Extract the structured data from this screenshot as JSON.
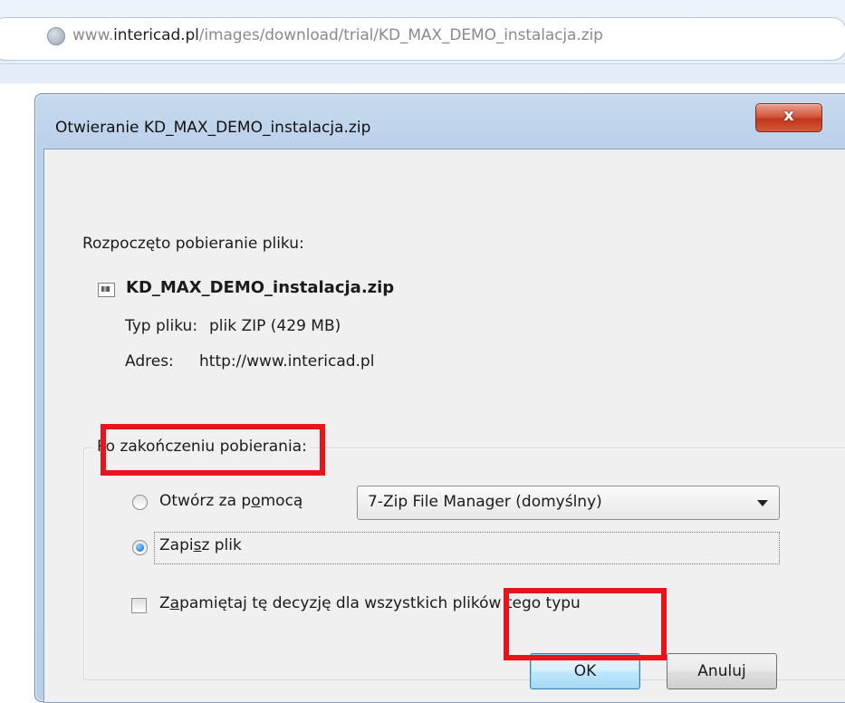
{
  "browser": {
    "url_prefix": "www.",
    "url_domain": "intericad.pl",
    "url_path": "/images/download/trial/KD_MAX_DEMO_instalacja.zip"
  },
  "dialog": {
    "title": "Otwieranie KD_MAX_DEMO_instalacja.zip",
    "close_label": "x",
    "download_started": "Rozpoczęto pobieranie pliku:",
    "file_name": "KD_MAX_DEMO_instalacja.zip",
    "file_type_label": "Typ pliku:",
    "file_type_value": "plik ZIP (429 MB)",
    "address_label": "Adres:",
    "address_value": "http://www.intericad.pl",
    "after_download_legend": "Po zakończeniu pobierania:",
    "open_with_pre": "Otwórz za p",
    "open_with_accel": "o",
    "open_with_post": "mocą",
    "open_with_app": "7-Zip File Manager (domyślny)",
    "save_pre": "Zapi",
    "save_accel": "s",
    "save_post": "z plik",
    "remember_pre": "Z",
    "remember_accel": "a",
    "remember_post": "pamiętaj tę decyzję dla wszystkich plików tego typu",
    "ok_label": "OK",
    "cancel_label": "Anuluj"
  },
  "state": {
    "selected_option": "save",
    "remember_checked": false
  },
  "colors": {
    "highlight": "#e8141b",
    "title_bar": "#bcd1ea",
    "close_button": "#c2361b"
  },
  "icons": [
    "globe-icon",
    "close-icon",
    "zip-file-icon",
    "dropdown-arrow-icon"
  ]
}
